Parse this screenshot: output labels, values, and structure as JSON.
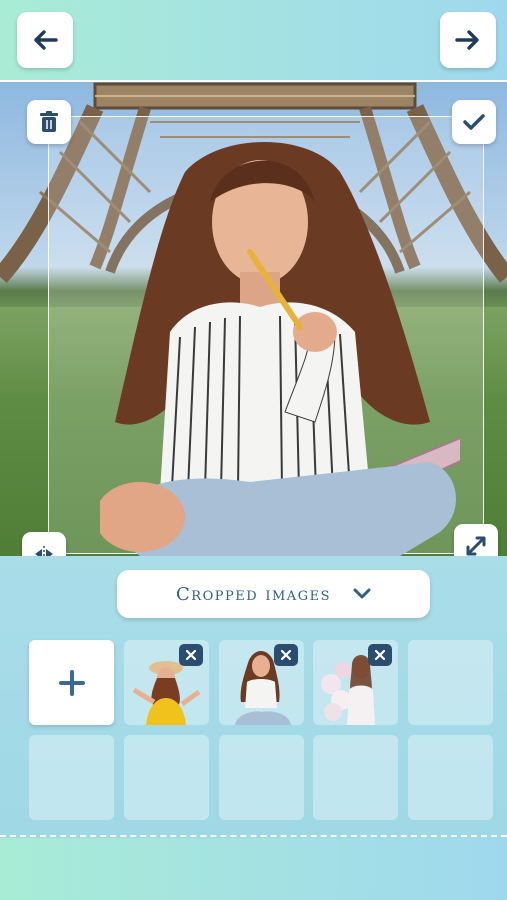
{
  "toolbar": {
    "back_icon": "arrow-left-icon",
    "next_icon": "arrow-right-icon"
  },
  "canvas": {
    "delete_icon": "trash-icon",
    "confirm_icon": "check-icon",
    "flip_icon": "flip-horizontal-icon",
    "resize_icon": "resize-diagonal-icon"
  },
  "panel": {
    "dropdown_label": "Cropped images",
    "dropdown_icon": "chevron-down-icon",
    "add_icon": "plus-icon",
    "thumbnails": [
      {
        "remove_icon": "close-icon"
      },
      {
        "remove_icon": "close-icon"
      },
      {
        "remove_icon": "close-icon"
      }
    ]
  },
  "colors": {
    "accent": "#2b4e70",
    "gradient_start": "#a8ecd6",
    "gradient_end": "#9fd8ee"
  }
}
